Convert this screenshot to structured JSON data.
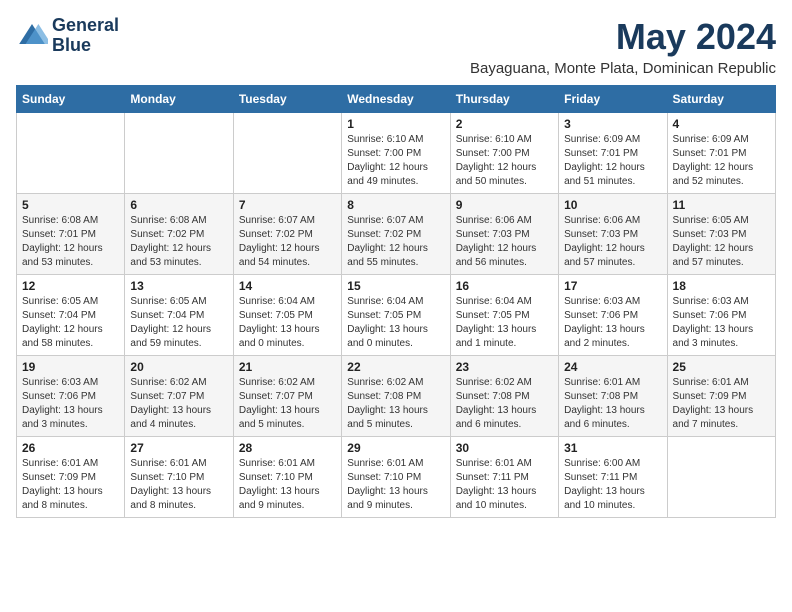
{
  "header": {
    "logo_line1": "General",
    "logo_line2": "Blue",
    "month_title": "May 2024",
    "location": "Bayaguana, Monte Plata, Dominican Republic"
  },
  "days_of_week": [
    "Sunday",
    "Monday",
    "Tuesday",
    "Wednesday",
    "Thursday",
    "Friday",
    "Saturday"
  ],
  "weeks": [
    [
      {
        "day": "",
        "info": ""
      },
      {
        "day": "",
        "info": ""
      },
      {
        "day": "",
        "info": ""
      },
      {
        "day": "1",
        "info": "Sunrise: 6:10 AM\nSunset: 7:00 PM\nDaylight: 12 hours\nand 49 minutes."
      },
      {
        "day": "2",
        "info": "Sunrise: 6:10 AM\nSunset: 7:00 PM\nDaylight: 12 hours\nand 50 minutes."
      },
      {
        "day": "3",
        "info": "Sunrise: 6:09 AM\nSunset: 7:01 PM\nDaylight: 12 hours\nand 51 minutes."
      },
      {
        "day": "4",
        "info": "Sunrise: 6:09 AM\nSunset: 7:01 PM\nDaylight: 12 hours\nand 52 minutes."
      }
    ],
    [
      {
        "day": "5",
        "info": "Sunrise: 6:08 AM\nSunset: 7:01 PM\nDaylight: 12 hours\nand 53 minutes."
      },
      {
        "day": "6",
        "info": "Sunrise: 6:08 AM\nSunset: 7:02 PM\nDaylight: 12 hours\nand 53 minutes."
      },
      {
        "day": "7",
        "info": "Sunrise: 6:07 AM\nSunset: 7:02 PM\nDaylight: 12 hours\nand 54 minutes."
      },
      {
        "day": "8",
        "info": "Sunrise: 6:07 AM\nSunset: 7:02 PM\nDaylight: 12 hours\nand 55 minutes."
      },
      {
        "day": "9",
        "info": "Sunrise: 6:06 AM\nSunset: 7:03 PM\nDaylight: 12 hours\nand 56 minutes."
      },
      {
        "day": "10",
        "info": "Sunrise: 6:06 AM\nSunset: 7:03 PM\nDaylight: 12 hours\nand 57 minutes."
      },
      {
        "day": "11",
        "info": "Sunrise: 6:05 AM\nSunset: 7:03 PM\nDaylight: 12 hours\nand 57 minutes."
      }
    ],
    [
      {
        "day": "12",
        "info": "Sunrise: 6:05 AM\nSunset: 7:04 PM\nDaylight: 12 hours\nand 58 minutes."
      },
      {
        "day": "13",
        "info": "Sunrise: 6:05 AM\nSunset: 7:04 PM\nDaylight: 12 hours\nand 59 minutes."
      },
      {
        "day": "14",
        "info": "Sunrise: 6:04 AM\nSunset: 7:05 PM\nDaylight: 13 hours\nand 0 minutes."
      },
      {
        "day": "15",
        "info": "Sunrise: 6:04 AM\nSunset: 7:05 PM\nDaylight: 13 hours\nand 0 minutes."
      },
      {
        "day": "16",
        "info": "Sunrise: 6:04 AM\nSunset: 7:05 PM\nDaylight: 13 hours\nand 1 minute."
      },
      {
        "day": "17",
        "info": "Sunrise: 6:03 AM\nSunset: 7:06 PM\nDaylight: 13 hours\nand 2 minutes."
      },
      {
        "day": "18",
        "info": "Sunrise: 6:03 AM\nSunset: 7:06 PM\nDaylight: 13 hours\nand 3 minutes."
      }
    ],
    [
      {
        "day": "19",
        "info": "Sunrise: 6:03 AM\nSunset: 7:06 PM\nDaylight: 13 hours\nand 3 minutes."
      },
      {
        "day": "20",
        "info": "Sunrise: 6:02 AM\nSunset: 7:07 PM\nDaylight: 13 hours\nand 4 minutes."
      },
      {
        "day": "21",
        "info": "Sunrise: 6:02 AM\nSunset: 7:07 PM\nDaylight: 13 hours\nand 5 minutes."
      },
      {
        "day": "22",
        "info": "Sunrise: 6:02 AM\nSunset: 7:08 PM\nDaylight: 13 hours\nand 5 minutes."
      },
      {
        "day": "23",
        "info": "Sunrise: 6:02 AM\nSunset: 7:08 PM\nDaylight: 13 hours\nand 6 minutes."
      },
      {
        "day": "24",
        "info": "Sunrise: 6:01 AM\nSunset: 7:08 PM\nDaylight: 13 hours\nand 6 minutes."
      },
      {
        "day": "25",
        "info": "Sunrise: 6:01 AM\nSunset: 7:09 PM\nDaylight: 13 hours\nand 7 minutes."
      }
    ],
    [
      {
        "day": "26",
        "info": "Sunrise: 6:01 AM\nSunset: 7:09 PM\nDaylight: 13 hours\nand 8 minutes."
      },
      {
        "day": "27",
        "info": "Sunrise: 6:01 AM\nSunset: 7:10 PM\nDaylight: 13 hours\nand 8 minutes."
      },
      {
        "day": "28",
        "info": "Sunrise: 6:01 AM\nSunset: 7:10 PM\nDaylight: 13 hours\nand 9 minutes."
      },
      {
        "day": "29",
        "info": "Sunrise: 6:01 AM\nSunset: 7:10 PM\nDaylight: 13 hours\nand 9 minutes."
      },
      {
        "day": "30",
        "info": "Sunrise: 6:01 AM\nSunset: 7:11 PM\nDaylight: 13 hours\nand 10 minutes."
      },
      {
        "day": "31",
        "info": "Sunrise: 6:00 AM\nSunset: 7:11 PM\nDaylight: 13 hours\nand 10 minutes."
      },
      {
        "day": "",
        "info": ""
      }
    ]
  ]
}
